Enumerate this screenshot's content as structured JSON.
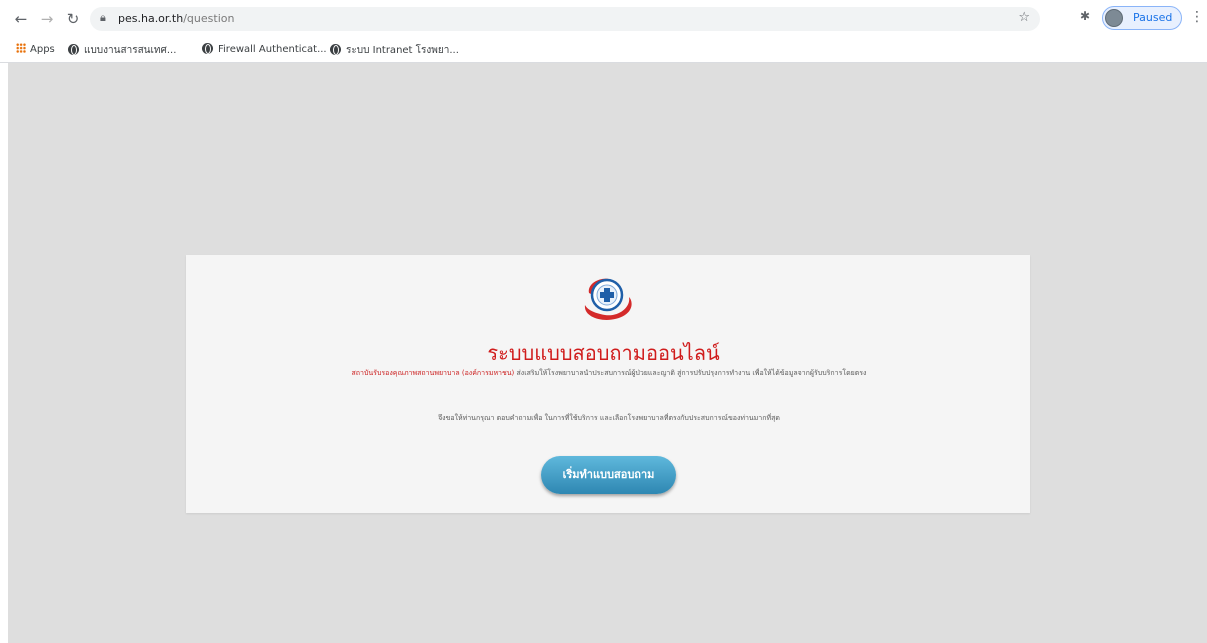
{
  "browser": {
    "url_domain": "pes.ha.or.th",
    "url_path": "/question",
    "profile_label": "Paused",
    "bookmarks": [
      {
        "label": "Apps"
      },
      {
        "label": "แบบงานสารสนเทศ..."
      },
      {
        "label": "Firewall Authenticat..."
      },
      {
        "label": "ระบบ Intranet โรงพยา..."
      }
    ]
  },
  "page": {
    "title": "ระบบแบบสอบถามออนไลน์",
    "description_highlight": "สถาบันรับรองคุณภาพสถานพยาบาล (องค์การมหาชน)",
    "description_rest": "ส่งเสริมให้โรงพยาบาลนำประสบการณ์ผู้ป่วยและญาติ สู่การปรับปรุงการทำงาน เพื่อให้ได้ข้อมูลจากผู้รับบริการโดยตรง",
    "description_line2": "จึงขอให้ท่านกรุณา ตอบคำถามเพื่อ ในการที่ใช้บริการ และเลือกโรงพยาบาลที่ตรงกับประสบการณ์ของท่านมากที่สุด",
    "start_button": "เริ่มทำแบบสอบถาม"
  },
  "colors": {
    "title": "#d01c1c",
    "button_top": "#5fb8dc",
    "button_bottom": "#2e87b2",
    "page_background": "#dedede",
    "card_background": "#f5f5f5"
  }
}
